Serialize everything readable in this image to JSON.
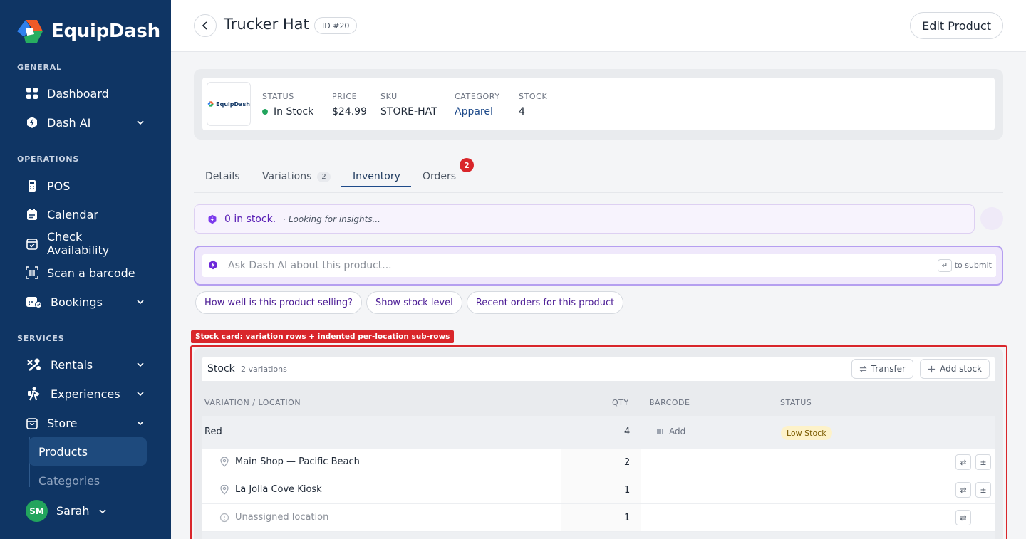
{
  "brand": {
    "name": "EquipDash"
  },
  "sidebar": {
    "sections": [
      {
        "label": "GENERAL"
      },
      {
        "label": "OPERATIONS"
      },
      {
        "label": "SERVICES"
      }
    ],
    "items": [
      {
        "label": "Dashboard",
        "icon": "grid-icon"
      },
      {
        "label": "Dash AI",
        "icon": "dash-ai-icon"
      },
      {
        "label": "POS",
        "icon": "pos-terminal-icon"
      },
      {
        "label": "Calendar",
        "icon": "calendar-icon"
      },
      {
        "label": "Check Availability",
        "icon": "calendar-check-icon"
      },
      {
        "label": "Scan a barcode",
        "icon": "barcode-scan-icon"
      },
      {
        "label": "Bookings",
        "icon": "bookings-icon"
      },
      {
        "label": "Rentals",
        "icon": "rentals-icon"
      },
      {
        "label": "Experiences",
        "icon": "experiences-icon"
      },
      {
        "label": "Store",
        "icon": "store-bag-icon"
      }
    ],
    "sub_items": [
      {
        "label": "Products",
        "active": true
      },
      {
        "label": "Categories",
        "active": false
      }
    ],
    "user": {
      "initials": "SM",
      "name": "Sarah",
      "avatar_color": "#22a45d"
    }
  },
  "header": {
    "title": "Trucker Hat",
    "id_badge": "ID #20",
    "edit_label": "Edit Product"
  },
  "product": {
    "logo_text": "EquipDash",
    "fields": [
      {
        "label": "STATUS",
        "value": "In Stock"
      },
      {
        "label": "PRICE",
        "value": "$24.99"
      },
      {
        "label": "SKU",
        "value": "STORE-HAT"
      },
      {
        "label": "CATEGORY",
        "value": "Apparel"
      },
      {
        "label": "STOCK",
        "value": "4"
      }
    ]
  },
  "tabs": [
    {
      "label": "Details"
    },
    {
      "label": "Variations",
      "count": "2"
    },
    {
      "label": "Inventory",
      "active": true
    },
    {
      "label": "Orders",
      "badge": "2"
    }
  ],
  "insight": {
    "main": "0 in stock.",
    "sub": "· Looking for insights..."
  },
  "ask_ai": {
    "placeholder": "Ask Dash AI about this product...",
    "enter_key": "↵",
    "hint": "to submit"
  },
  "suggestions": [
    "How well is this product selling?",
    "Show stock level",
    "Recent orders for this product"
  ],
  "annotation": "Stock card: variation rows + indented per-location sub-rows",
  "stock": {
    "title": "Stock",
    "subtitle": "2 variations",
    "transfer_label": "Transfer",
    "add_stock_label": "Add stock",
    "columns": [
      "VARIATION / LOCATION",
      "QTY",
      "BARCODE",
      "STATUS"
    ],
    "variation": {
      "name": "Red",
      "qty": "4",
      "barcode_action": "Add",
      "status": "Low Stock"
    },
    "locations": [
      {
        "name": "Main Shop — Pacific Beach",
        "qty": "2"
      },
      {
        "name": "La Jolla Cove Kiosk",
        "qty": "1"
      },
      {
        "name": "Unassigned location",
        "qty": "1"
      }
    ]
  },
  "colors": {
    "sidebar_bg": "#0f3564",
    "accent_purple": "#5b21b6",
    "alert_red": "#d9262b",
    "success_green": "#22a45d"
  }
}
